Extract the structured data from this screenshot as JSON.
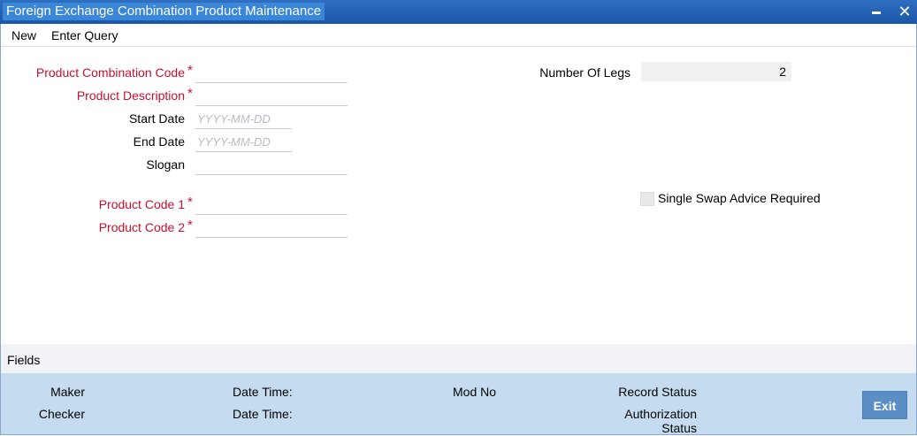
{
  "window": {
    "title": "Foreign Exchange Combination Product Maintenance",
    "close_glyph": "✕"
  },
  "menu": {
    "new": "New",
    "enter_query": "Enter Query"
  },
  "form": {
    "product_combination_code": {
      "label": "Product Combination Code",
      "value": ""
    },
    "product_description": {
      "label": "Product Description",
      "value": ""
    },
    "start_date": {
      "label": "Start Date",
      "placeholder": "YYYY-MM-DD"
    },
    "end_date": {
      "label": "End Date",
      "placeholder": "YYYY-MM-DD"
    },
    "slogan": {
      "label": "Slogan",
      "value": ""
    },
    "product_code_1": {
      "label": "Product Code 1",
      "value": ""
    },
    "product_code_2": {
      "label": "Product Code 2",
      "value": ""
    },
    "number_of_legs": {
      "label": "Number Of Legs",
      "value": "2"
    },
    "single_swap_advice": {
      "label": "Single Swap Advice Required",
      "checked": false
    },
    "required_marker": "*"
  },
  "fields_section": {
    "label": "Fields"
  },
  "footer": {
    "maker": "Maker",
    "checker": "Checker",
    "date_time_1": "Date Time:",
    "date_time_2": "Date Time:",
    "mod_no": "Mod No",
    "record_status": "Record Status",
    "authorization": "Authorization",
    "status": "Status",
    "exit": "Exit"
  },
  "colors": {
    "title_bar": "#1b56a8",
    "required": "#c8102e",
    "footer": "#c5dcf0",
    "exit_button": "#5b8ec5"
  }
}
